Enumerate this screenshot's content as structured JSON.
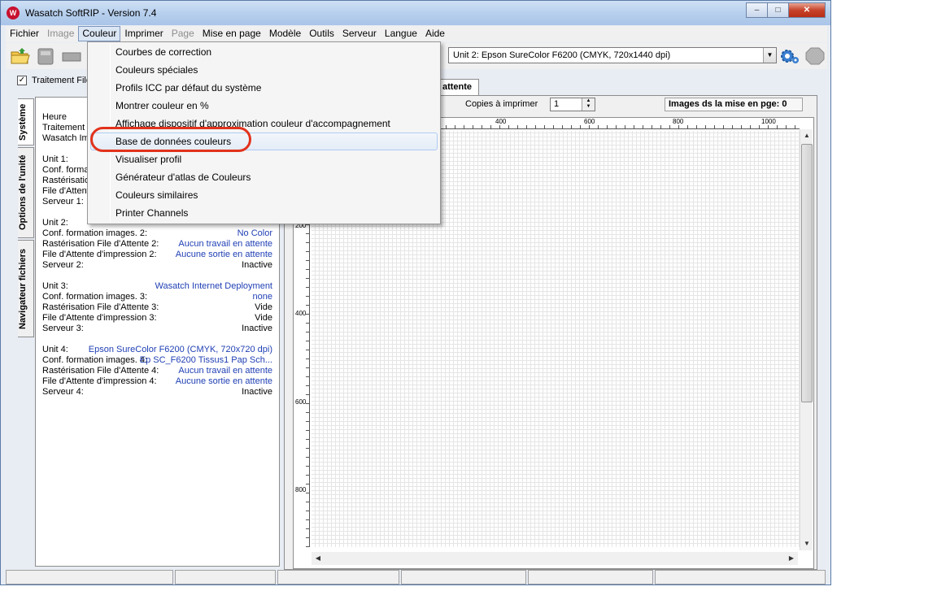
{
  "window": {
    "title": "Wasatch SoftRIP - Version 7.4",
    "app_icon_text": "W",
    "controls": {
      "minimize": "–",
      "maximize": "□",
      "close": "✕"
    }
  },
  "menu": {
    "items": [
      {
        "label": "Fichier",
        "disabled": false
      },
      {
        "label": "Image",
        "disabled": true
      },
      {
        "label": "Couleur",
        "disabled": false,
        "open": true
      },
      {
        "label": "Imprimer",
        "disabled": false
      },
      {
        "label": "Page",
        "disabled": true
      },
      {
        "label": "Mise en page",
        "disabled": false
      },
      {
        "label": "Modèle",
        "disabled": false
      },
      {
        "label": "Outils",
        "disabled": false
      },
      {
        "label": "Serveur",
        "disabled": false
      },
      {
        "label": "Langue",
        "disabled": false
      },
      {
        "label": "Aide",
        "disabled": false
      }
    ]
  },
  "couleur_menu": {
    "items": [
      "Courbes de correction",
      "Couleurs spéciales",
      "Profils ICC par défaut du système",
      "Montrer couleur en %",
      "Affichage dispositif d'approximation couleur d'accompagnement",
      "Base de données couleurs",
      "Visualiser profil",
      "Générateur d'atlas de Couleurs",
      "Couleurs similaires",
      "Printer Channels"
    ],
    "highlighted_index": 5
  },
  "toolbar": {
    "unit_select_value": "Unit 2: Epson  SureColor F6200  (CMYK, 720x1440 dpi)",
    "dropdown_arrow": "▼"
  },
  "left": {
    "checkbox_label": "Traitement File",
    "checkbox_mark": "✓",
    "vtabs": [
      "Système",
      "Options de l'unité",
      "Navigateur fichiers"
    ],
    "header_lines": [
      "Heure",
      "Traitement I",
      "Wasatch Im"
    ],
    "unit1_lines": [
      "Unit 1:",
      "Conf. format",
      "Rastérisation",
      "File d'Attent",
      "Serveur 1:"
    ],
    "units": [
      {
        "rows": [
          {
            "label": "Conf. formation images. 2:",
            "value": "No Color",
            "blue": true
          },
          {
            "label": "Rastérisation File d'Attente 2:",
            "value": "Aucun travail en attente",
            "blue": true
          },
          {
            "label": "File d'Attente d'impression 2:",
            "value": "Aucune sortie en attente",
            "blue": true
          },
          {
            "label": "Serveur 2:",
            "value": "Inactive",
            "blue": false
          }
        ],
        "header": "Unit 2:"
      },
      {
        "header": "Unit 3:",
        "header_value": "Wasatch  Internet Deployment",
        "rows": [
          {
            "label": "Conf. formation images. 3:",
            "value": "none",
            "blue": true
          },
          {
            "label": "Rastérisation File d'Attente 3:",
            "value": "Vide",
            "blue": false
          },
          {
            "label": "File d'Attente d'impression 3:",
            "value": "Vide",
            "blue": false
          },
          {
            "label": "Serveur 3:",
            "value": "Inactive",
            "blue": false
          }
        ]
      },
      {
        "header": "Unit 4:",
        "header_value": "Epson  SureColor F6200  (CMYK, 720x720 dpi)",
        "rows": [
          {
            "label": "Conf. formation images. 4:",
            "value": "Ep SC_F6200 Tissus1 Pap Sch...",
            "blue": true
          },
          {
            "label": "Rastérisation File d'Attente 4:",
            "value": "Aucun travail en attente",
            "blue": true
          },
          {
            "label": "File d'Attente d'impression 4:",
            "value": "Aucune sortie en attente",
            "blue": true
          },
          {
            "label": "Serveur 4:",
            "value": "Inactive",
            "blue": false
          }
        ]
      }
    ]
  },
  "right": {
    "tab_label": "attente",
    "copies_label": "Copies à imprimer",
    "copies_value": "1",
    "images_count": "Images ds la mise en pge: 0",
    "ruler_top": [
      "400",
      "600",
      "800",
      "1000"
    ],
    "ruler_left": [
      "200",
      "400",
      "600",
      "800"
    ]
  }
}
